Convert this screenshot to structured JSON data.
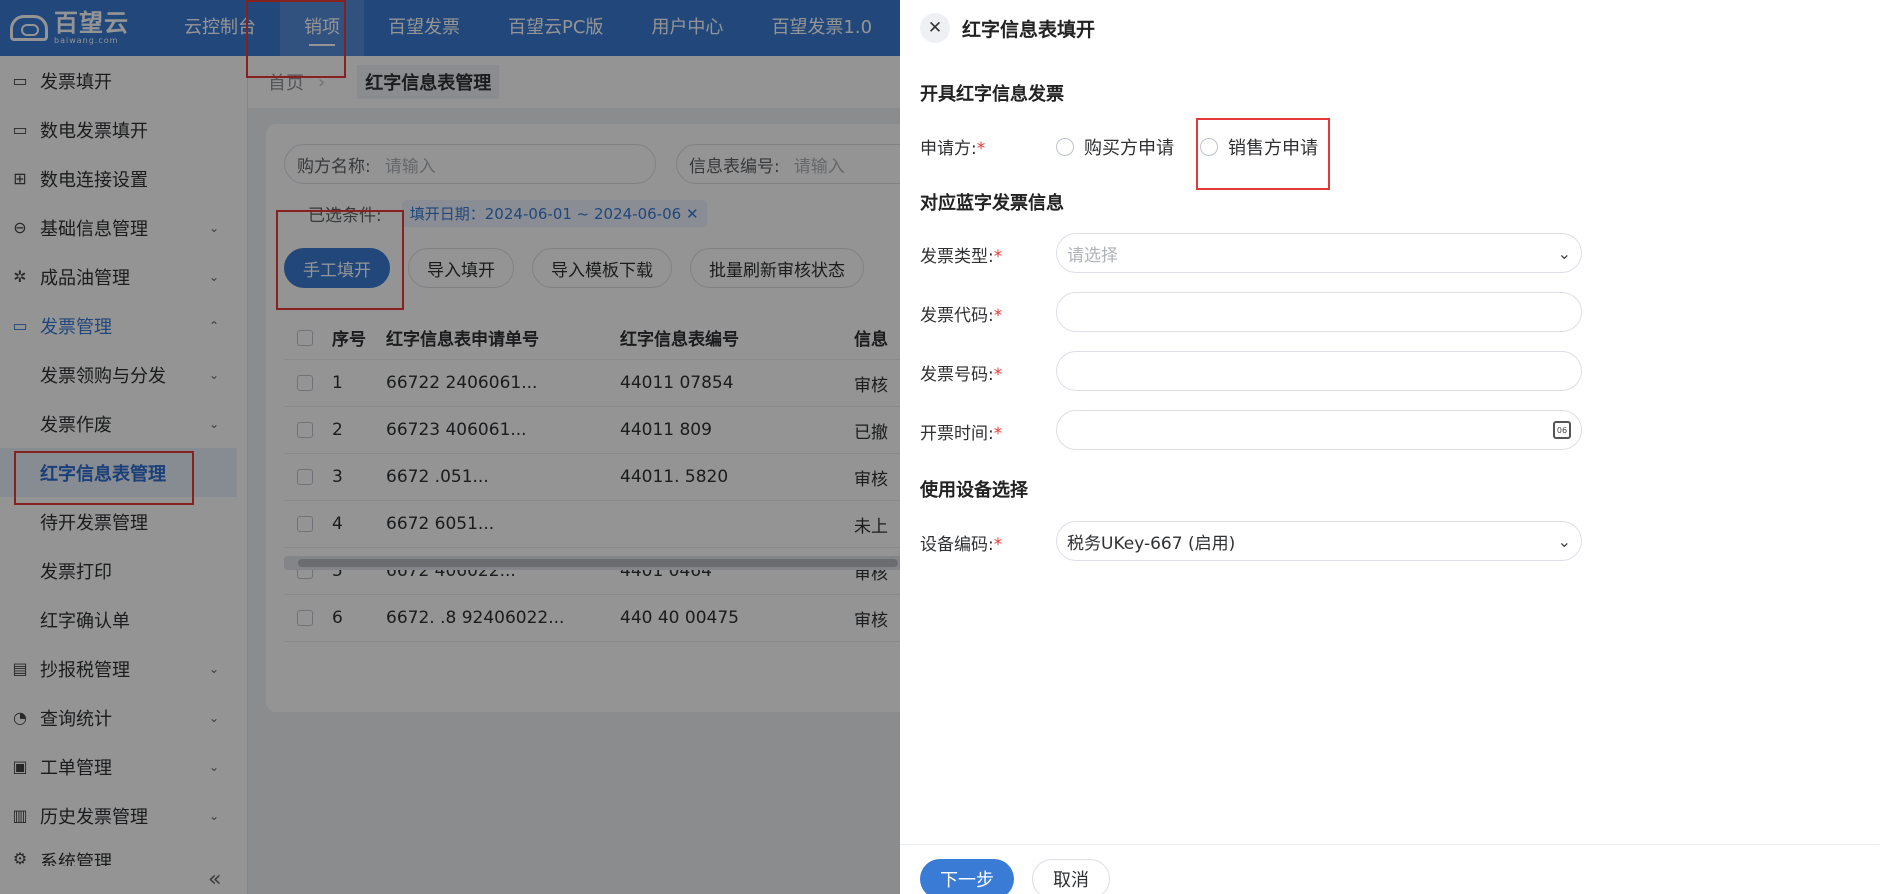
{
  "app": {
    "logo_cn": "百望云",
    "logo_en": "baiwang.com"
  },
  "topnav": {
    "items": [
      {
        "label": "云控制台"
      },
      {
        "label": "销项"
      },
      {
        "label": "百望发票"
      },
      {
        "label": "百望云PC版"
      },
      {
        "label": "用户中心"
      },
      {
        "label": "百望发票1.0"
      }
    ],
    "active": "销项"
  },
  "sidebar": {
    "items": [
      {
        "label": "发票填开",
        "icon": "invoice-icon"
      },
      {
        "label": "数电发票填开",
        "icon": "invoice-icon"
      },
      {
        "label": "数电连接设置",
        "icon": "grid-icon"
      },
      {
        "label": "基础信息管理",
        "icon": "info-icon"
      },
      {
        "label": "成品油管理",
        "icon": "gear-icon"
      },
      {
        "label": "发票管理",
        "icon": "invoice-icon"
      },
      {
        "label": "发票领购与分发"
      },
      {
        "label": "发票作废"
      },
      {
        "label": "红字信息表管理"
      },
      {
        "label": "待开发票管理"
      },
      {
        "label": "发票打印"
      },
      {
        "label": "红字确认单"
      },
      {
        "label": "抄报税管理",
        "icon": "ticket-icon"
      },
      {
        "label": "查询统计",
        "icon": "chart-icon"
      },
      {
        "label": "工单管理",
        "icon": "clipboard-icon"
      },
      {
        "label": "历史发票管理",
        "icon": "archive-icon"
      },
      {
        "label": "系统管理",
        "icon": "settings-icon"
      }
    ],
    "collapse_glyph": "«"
  },
  "breadcrumb": {
    "home": "首页",
    "current": "红字信息表管理"
  },
  "filters": {
    "buyer_label": "购方名称:",
    "buyer_placeholder": "请输入",
    "sheet_no_label": "信息表编号:",
    "sheet_no_placeholder": "请输入"
  },
  "conditions": {
    "label": "已选条件:",
    "tag": "填开日期：2024-06-01 ~ 2024-06-06 ✕"
  },
  "toolbar": {
    "manual": "手工填开",
    "import": "导入填开",
    "template": "导入模板下载",
    "refresh": "批量刷新审核状态"
  },
  "table": {
    "headers": [
      "序号",
      "红字信息表申请单号",
      "红字信息表编号",
      "信息"
    ],
    "rows": [
      [
        "1",
        "66722      2406061...",
        "44011      07854",
        "审核"
      ],
      [
        "2",
        "66723      406061...",
        "44011      809",
        "已撤"
      ],
      [
        "3",
        "6672      .051...",
        "44011.      5820",
        "审核"
      ],
      [
        "4",
        "6672      6051...",
        "",
        "未上"
      ],
      [
        "5",
        "6672      406022...",
        "4401      0464",
        "审核"
      ],
      [
        "6",
        "6672.  .8   92406022...",
        "440   40  00475",
        "审核"
      ]
    ]
  },
  "drawer": {
    "title": "红字信息表填开",
    "close_glyph": "✕",
    "section1": "开具红字信息发票",
    "applicant_label": "申请方:",
    "required_mark": "*",
    "radio_buyer": "购买方申请",
    "radio_seller": "销售方申请",
    "section2": "对应蓝字发票信息",
    "invoice_type_label": "发票类型:",
    "invoice_type_placeholder": "请选择",
    "invoice_code_label": "发票代码:",
    "invoice_number_label": "发票号码:",
    "issue_time_label": "开票时间:",
    "calendar_glyph": "06",
    "section3": "使用设备选择",
    "device_label": "设备编码:",
    "device_value": "税务UKey-667          (启用)",
    "next_button": "下一步",
    "cancel_button": "取消"
  },
  "colors": {
    "brand": "#3a7bd5",
    "highlight": "#e53935"
  }
}
